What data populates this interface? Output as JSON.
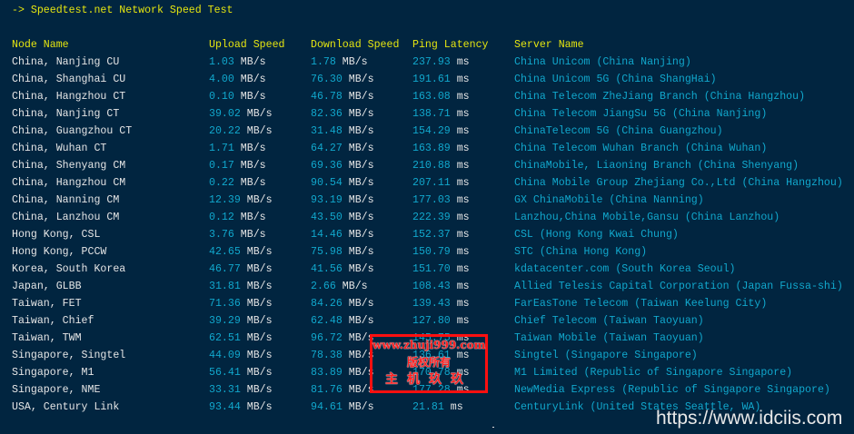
{
  "title": "-> Speedtest.net Network Speed Test",
  "headers": [
    "Node Name",
    "Upload Speed",
    "Download Speed",
    "Ping Latency",
    "Server Name"
  ],
  "rows": [
    {
      "node": "China, Nanjing CU",
      "up": "1.03",
      "down": "1.78",
      "ping": "237.93",
      "server": "China Unicom (China Nanjing)"
    },
    {
      "node": "China, Shanghai CU",
      "up": "4.00",
      "down": "76.30",
      "ping": "191.61",
      "server": "China Unicom 5G (China ShangHai)"
    },
    {
      "node": "China, Hangzhou CT",
      "up": "0.10",
      "down": "46.78",
      "ping": "163.08",
      "server": "China Telecom ZheJiang Branch (China Hangzhou)"
    },
    {
      "node": "China, Nanjing CT",
      "up": "39.02",
      "down": "82.36",
      "ping": "138.71",
      "server": "China Telecom JiangSu 5G (China Nanjing)"
    },
    {
      "node": "China, Guangzhou CT",
      "up": "20.22",
      "down": "31.48",
      "ping": "154.29",
      "server": "ChinaTelecom 5G (China Guangzhou)"
    },
    {
      "node": "China, Wuhan CT",
      "up": "1.71",
      "down": "64.27",
      "ping": "163.89",
      "server": "China Telecom Wuhan Branch (China Wuhan)"
    },
    {
      "node": "China, Shenyang CM",
      "up": "0.17",
      "down": "69.36",
      "ping": "210.88",
      "server": "ChinaMobile, Liaoning Branch (China Shenyang)"
    },
    {
      "node": "China, Hangzhou CM",
      "up": "0.22",
      "down": "90.54",
      "ping": "207.11",
      "server": "China Mobile Group Zhejiang Co.,Ltd (China Hangzhou)"
    },
    {
      "node": "China, Nanning CM",
      "up": "12.39",
      "down": "93.19",
      "ping": "177.03",
      "server": "GX ChinaMobile (China Nanning)"
    },
    {
      "node": "China, Lanzhou CM",
      "up": "0.12",
      "down": "43.50",
      "ping": "222.39",
      "server": "Lanzhou,China Mobile,Gansu (China Lanzhou)"
    },
    {
      "node": "Hong Kong, CSL",
      "up": "3.76",
      "down": "14.46",
      "ping": "152.37",
      "server": "CSL (Hong Kong Kwai Chung)"
    },
    {
      "node": "Hong Kong, PCCW",
      "up": "42.65",
      "down": "75.98",
      "ping": "150.79",
      "server": "STC (China Hong Kong)"
    },
    {
      "node": "Korea, South Korea",
      "up": "46.77",
      "down": "41.56",
      "ping": "151.70",
      "server": "kdatacenter.com (South Korea Seoul)"
    },
    {
      "node": "Japan, GLBB",
      "up": "31.81",
      "down": "2.66",
      "ping": "108.43",
      "server": "Allied Telesis Capital Corporation (Japan Fussa-shi)"
    },
    {
      "node": "Taiwan, FET",
      "up": "71.36",
      "down": "84.26",
      "ping": "139.43",
      "server": "FarEasTone Telecom (Taiwan Keelung City)"
    },
    {
      "node": "Taiwan, Chief",
      "up": "39.29",
      "down": "62.48",
      "ping": "127.80",
      "server": "Chief Telecom (Taiwan Taoyuan)"
    },
    {
      "node": "Taiwan, TWM",
      "up": "62.51",
      "down": "96.72",
      "ping": "145.75",
      "server": "Taiwan Mobile (Taiwan Taoyuan)"
    },
    {
      "node": "Singapore, Singtel",
      "up": "44.09",
      "down": "78.38",
      "ping": "136.61",
      "server": "Singtel (Singapore Singapore)"
    },
    {
      "node": "Singapore, M1",
      "up": "56.41",
      "down": "83.89",
      "ping": "170.78",
      "server": "M1 Limited (Republic of Singapore Singapore)"
    },
    {
      "node": "Singapore, NME",
      "up": "33.31",
      "down": "81.76",
      "ping": "177.28",
      "server": "NewMedia Express (Republic of Singapore Singapore)"
    },
    {
      "node": "USA, Century Link",
      "up": "93.44",
      "down": "94.61",
      "ping": "21.81",
      "server": "CenturyLink (United States Seattle, WA)"
    }
  ],
  "units": {
    "speed": " MB/s",
    "ping": " ms"
  },
  "watermark": {
    "line1": "www.zhuji999.com",
    "line2": "版权所有",
    "line3": "主机玖玖"
  },
  "site_watermark": "https://www.idciis.com",
  "colors": {
    "background": "#012540",
    "header": "#e5e510",
    "value": "#11a8cd",
    "text": "#e6e6e6",
    "watermark": "#ff1010"
  }
}
